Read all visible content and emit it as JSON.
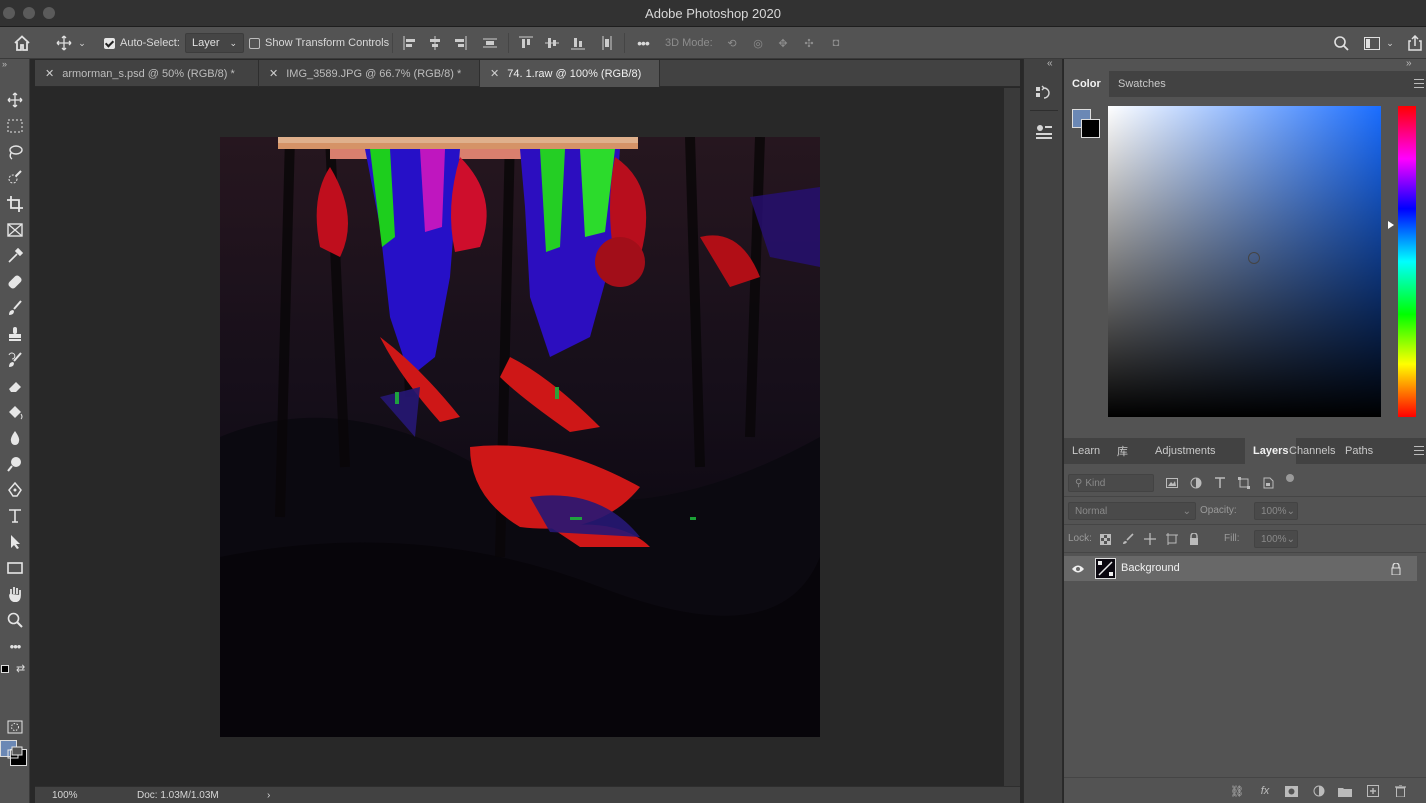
{
  "window": {
    "title": "Adobe Photoshop 2020"
  },
  "options_bar": {
    "auto_select_label": "Auto-Select:",
    "auto_select_checked": true,
    "auto_select_target": "Layer",
    "show_transform_label": "Show Transform Controls",
    "show_transform_checked": false,
    "more_label": "•••",
    "mode_3d_label": "3D Mode:"
  },
  "tabs": [
    {
      "label": "armorman_s.psd @ 50% (RGB/8) *",
      "active": false
    },
    {
      "label": "IMG_3589.JPG @ 66.7% (RGB/8) *",
      "active": false
    },
    {
      "label": "74. 1.raw @ 100% (RGB/8)",
      "active": true
    }
  ],
  "status": {
    "zoom": "100%",
    "doc": "Doc: 1.03M/1.03M",
    "arrow": "›"
  },
  "toolbox": {
    "tools": [
      "move-tool",
      "marquee-tool",
      "lasso-tool",
      "quick-select-tool",
      "crop-tool",
      "frame-tool",
      "eyedropper-tool",
      "healing-brush-tool",
      "brush-tool",
      "clone-stamp-tool",
      "history-brush-tool",
      "eraser-tool",
      "paint-bucket-tool",
      "blur-tool",
      "dodge-tool",
      "pen-tool",
      "type-tool",
      "path-select-tool",
      "rectangle-tool",
      "hand-tool",
      "zoom-tool",
      "more-tools"
    ],
    "foreground_color": "#6b88b5",
    "background_color": "#000000"
  },
  "color_panel": {
    "tabs": [
      "Color",
      "Swatches"
    ],
    "active_tab": "Color",
    "foreground_color": "#6b88b5",
    "background_color": "#000000"
  },
  "layers_panel": {
    "tabs": [
      "Learn",
      "库",
      "Adjustments",
      "Layers",
      "Channels",
      "Paths"
    ],
    "active_tab": "Layers",
    "filter_placeholder": "Kind",
    "blend_mode": "Normal",
    "opacity_label": "Opacity:",
    "opacity_value": "100%",
    "lock_label": "Lock:",
    "fill_label": "Fill:",
    "fill_value": "100%",
    "layers": [
      {
        "name": "Background",
        "visible": true,
        "locked": true
      }
    ]
  }
}
